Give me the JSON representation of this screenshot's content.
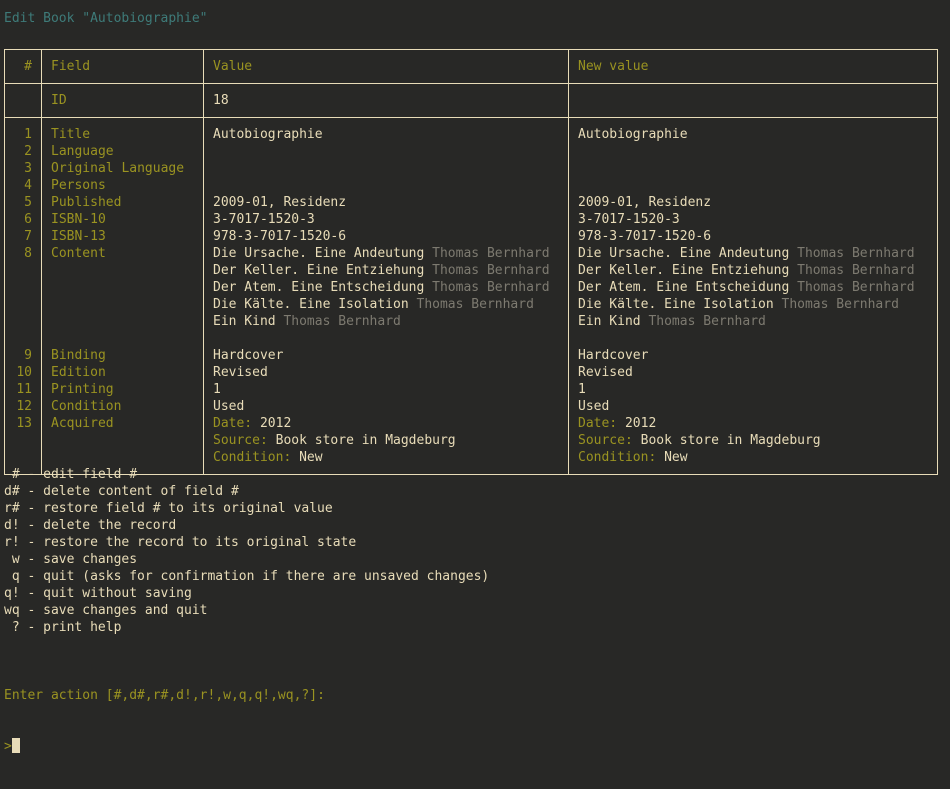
{
  "title": "Edit Book \"Autobiographie\"",
  "table": {
    "headers": {
      "num": "#",
      "field": "Field",
      "value": "Value",
      "new_value": "New value"
    },
    "id_row": {
      "num": "",
      "field": "ID",
      "value": "18",
      "new_value": ""
    },
    "rows": [
      {
        "num": "1",
        "field": "Title",
        "value": "Autobiographie",
        "new_value": "Autobiographie"
      },
      {
        "num": "2",
        "field": "Language",
        "value": "",
        "new_value": ""
      },
      {
        "num": "3",
        "field": "Original Language",
        "value": "",
        "new_value": ""
      },
      {
        "num": "4",
        "field": "Persons",
        "value": "",
        "new_value": ""
      },
      {
        "num": "5",
        "field": "Published",
        "value": "2009-01, Residenz",
        "new_value": "2009-01, Residenz"
      },
      {
        "num": "6",
        "field": "ISBN-10",
        "value": "3-7017-1520-3",
        "new_value": "3-7017-1520-3"
      },
      {
        "num": "7",
        "field": "ISBN-13",
        "value": "978-3-7017-1520-6",
        "new_value": "978-3-7017-1520-6"
      },
      {
        "num": "8",
        "field": "Content",
        "value": "",
        "new_value": ""
      },
      {
        "num": "9",
        "field": "Binding",
        "value": "Hardcover",
        "new_value": "Hardcover"
      },
      {
        "num": "10",
        "field": "Edition",
        "value": "Revised",
        "new_value": "Revised"
      },
      {
        "num": "11",
        "field": "Printing",
        "value": "1",
        "new_value": "1"
      },
      {
        "num": "12",
        "field": "Condition",
        "value": "Used",
        "new_value": "Used"
      },
      {
        "num": "13",
        "field": "Acquired",
        "value": "",
        "new_value": ""
      }
    ],
    "content_entries": [
      {
        "work": "Die Ursache. Eine Andeutung",
        "author": "Thomas Bernhard"
      },
      {
        "work": "Der Keller. Eine Entziehung",
        "author": "Thomas Bernhard"
      },
      {
        "work": "Der Atem. Eine Entscheidung",
        "author": "Thomas Bernhard"
      },
      {
        "work": "Die Kälte. Eine Isolation",
        "author": "Thomas Bernhard"
      },
      {
        "work": "Ein Kind",
        "author": "Thomas Bernhard"
      }
    ],
    "acquired_entries": [
      {
        "label": "Date:",
        "value": "2012"
      },
      {
        "label": "Source:",
        "value": "Book store in Magdeburg"
      },
      {
        "label": "Condition:",
        "value": "New"
      }
    ]
  },
  "help": [
    {
      "cmd": "#",
      "sep": " - ",
      "text": "edit field #"
    },
    {
      "cmd": "d#",
      "sep": " - ",
      "text": "delete content of field #"
    },
    {
      "cmd": "r#",
      "sep": " - ",
      "text": "restore field # to its original value"
    },
    {
      "cmd": "d!",
      "sep": " - ",
      "text": "delete the record"
    },
    {
      "cmd": "r!",
      "sep": " - ",
      "text": "restore the record to its original state"
    },
    {
      "cmd": "w",
      "sep": " - ",
      "text": "save changes"
    },
    {
      "cmd": "q",
      "sep": " - ",
      "text": "quit (asks for confirmation if there are unsaved changes)"
    },
    {
      "cmd": "q!",
      "sep": " - ",
      "text": "quit without saving"
    },
    {
      "cmd": "wq",
      "sep": " - ",
      "text": "save changes and quit"
    },
    {
      "cmd": "?",
      "sep": " - ",
      "text": "print help"
    }
  ],
  "prompt": {
    "text": "Enter action [#,d#,r#,d!,r!,w,q,q!,wq,?]:",
    "symbol": ">",
    "input_value": ""
  },
  "colors": {
    "background": "#282826",
    "title": "#3e7b79",
    "accent_olive": "#9a9321",
    "text_cream": "#e8dcb8",
    "text_dim": "#7d7a70",
    "border": "#e8dcb8"
  }
}
